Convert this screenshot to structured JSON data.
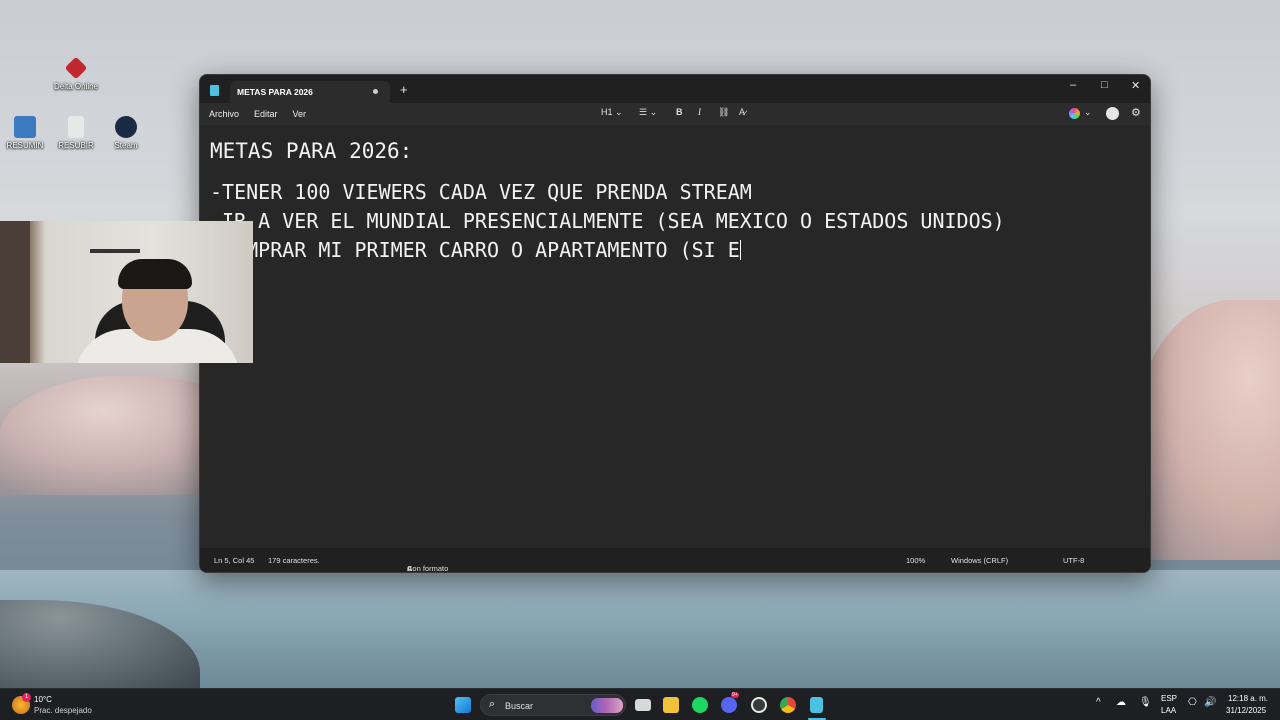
{
  "desktop": {
    "icons": [
      {
        "label": "Delta Online",
        "color": "#c0282e"
      },
      {
        "label": "RESUMIN",
        "color": "#3c7ac0"
      },
      {
        "label": "RESUBIR",
        "color": "#e8e8e8"
      },
      {
        "label": "Steam",
        "color": "#1b2a44"
      }
    ]
  },
  "window": {
    "tab_title": "METAS PARA 2026",
    "new_tab": "+",
    "controls": {
      "minimize": "–",
      "maximize": "□",
      "close": "✕"
    },
    "menu": {
      "file": "Archivo",
      "edit": "Editar",
      "view": "Ver"
    },
    "toolbar": {
      "heading": "H1",
      "list": "☰",
      "bold": "B",
      "italic": "I",
      "link": "⛓",
      "clear": "A̷"
    },
    "content": {
      "heading": "METAS PARA 2026:",
      "lines": [
        "-TENER 100 VIEWERS CADA VEZ QUE PRENDA STREAM",
        "-IR A VER EL MUNDIAL PRESENCIALMENTE (SEA MEXICO O ESTADOS UNIDOS)",
        "-COMPRAR MI PRIMER CARRO O APARTAMENTO (SI E"
      ]
    },
    "status": {
      "position": "Ln 5, Col 45",
      "chars": "179 caracteres.",
      "format": "Con formato",
      "zoom": "100%",
      "line_ending": "Windows (CRLF)",
      "encoding": "UTF-8"
    }
  },
  "taskbar": {
    "weather_temp": "10°C",
    "weather_desc": "Prac. despejado",
    "weather_badge": "1",
    "search_placeholder": "Buscar",
    "lang": "ESP",
    "lang_sub": "LAA",
    "time": "12:18 a. m.",
    "date": "31/12/2025",
    "discord_badge": "9+",
    "apps": [
      {
        "name": "windows-start",
        "color": "#3ea6f0"
      },
      {
        "name": "task-view",
        "color": "#d8d8d8"
      },
      {
        "name": "file-explorer",
        "color": "#f2c13c"
      },
      {
        "name": "spotify",
        "color": "#1ed760"
      },
      {
        "name": "discord",
        "color": "#5865f2"
      },
      {
        "name": "obs",
        "color": "#3a3a3a"
      },
      {
        "name": "chrome",
        "color": "#e8453c"
      },
      {
        "name": "notepad",
        "color": "#4cc2e3"
      }
    ]
  }
}
